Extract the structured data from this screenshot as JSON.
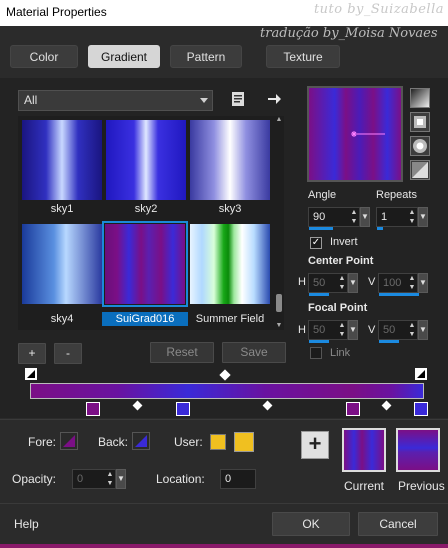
{
  "window": {
    "title": "Material Properties",
    "watermark_1": "tuto by_Suizabella",
    "watermark_2": "tradução by_Moisa Novaes"
  },
  "tabs": [
    {
      "label": "Color",
      "active": false
    },
    {
      "label": "Gradient",
      "active": true
    },
    {
      "label": "Pattern",
      "active": false
    },
    {
      "label": "Texture",
      "active": false
    }
  ],
  "category_select": {
    "value": "All"
  },
  "gradients": [
    {
      "name": "sky1"
    },
    {
      "name": "sky2"
    },
    {
      "name": "sky3"
    },
    {
      "name": "sky4"
    },
    {
      "name": "SuiGrad016",
      "selected": true
    },
    {
      "name": "Summer Field"
    }
  ],
  "buttons": {
    "add": "+",
    "remove": "-",
    "reset": "Reset",
    "save": "Save",
    "ok": "OK",
    "cancel": "Cancel",
    "help": "Help",
    "add_swatch": "+"
  },
  "settings": {
    "angle_label": "Angle",
    "angle_value": "90",
    "repeats_label": "Repeats",
    "repeats_value": "1",
    "invert_label": "Invert",
    "invert_checked": true,
    "center_point_label": "Center Point",
    "center_h_label": "H",
    "center_h_value": "50",
    "center_v_label": "V",
    "center_v_value": "100",
    "focal_point_label": "Focal Point",
    "focal_h_label": "H",
    "focal_h_value": "50",
    "focal_v_label": "V",
    "focal_v_value": "50",
    "link_label": "Link",
    "link_checked": false
  },
  "colors": {
    "fore_label": "Fore:",
    "back_label": "Back:",
    "user_label": "User:",
    "opacity_label": "Opacity:",
    "opacity_value": "0",
    "location_label": "Location:",
    "location_value": "0",
    "current_label": "Current",
    "previous_label": "Previous",
    "user_color": "#f0c020",
    "gradient_purple": "#7b0f86",
    "gradient_blue": "#3a2ad8",
    "accent": "#1b8ae0"
  }
}
